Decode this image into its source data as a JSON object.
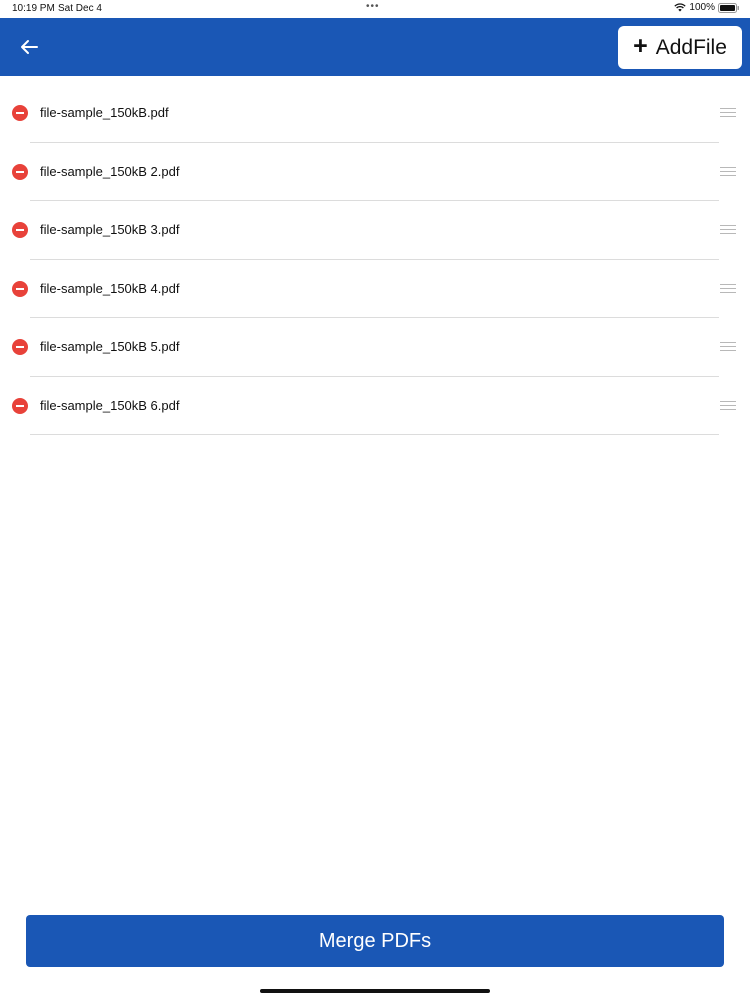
{
  "status_bar": {
    "time": "10:19 PM",
    "date": "Sat Dec 4",
    "battery": "100%"
  },
  "header": {
    "back_icon": "arrow-left-icon",
    "add_file_label": "AddFile",
    "accent_color": "#1a57b5"
  },
  "files": [
    {
      "name": "file-sample_150kB.pdf"
    },
    {
      "name": "file-sample_150kB 2.pdf"
    },
    {
      "name": "file-sample_150kB 3.pdf"
    },
    {
      "name": "file-sample_150kB 4.pdf"
    },
    {
      "name": "file-sample_150kB 5.pdf"
    },
    {
      "name": "file-sample_150kB 6.pdf"
    }
  ],
  "footer": {
    "merge_label": "Merge PDFs"
  }
}
